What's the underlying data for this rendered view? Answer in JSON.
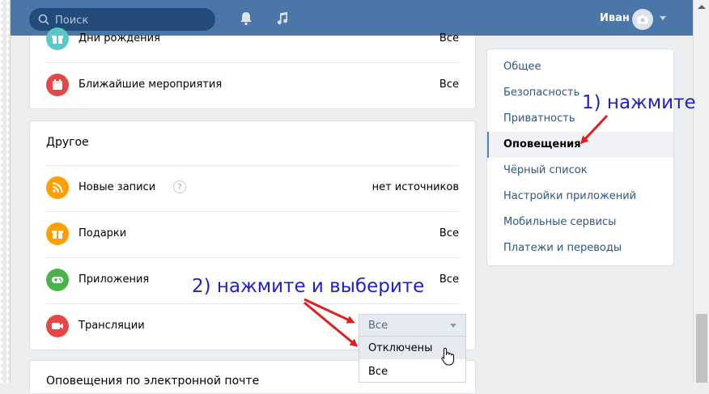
{
  "header": {
    "search_placeholder": "Поиск",
    "user_name": "Иван",
    "icons": [
      "search-icon",
      "bell-icon",
      "music-icon",
      "camera-icon",
      "chevron-down-icon"
    ]
  },
  "sections": {
    "events": {
      "rows": [
        {
          "label": "Дни рождения",
          "value": "Все",
          "icon": "gift-icon",
          "color": "#5ac8c8"
        },
        {
          "label": "Ближайшие мероприятия",
          "value": "Все",
          "icon": "calendar-icon",
          "color": "#e64646"
        }
      ]
    },
    "other": {
      "title": "Другое",
      "rows": [
        {
          "label": "Новые записи",
          "value": "нет источников",
          "icon": "rss-icon",
          "color": "#ffa000"
        },
        {
          "label": "Подарки",
          "value": "Все",
          "icon": "gift-icon",
          "color": "#ffa000"
        },
        {
          "label": "Приложения",
          "value": "Все",
          "icon": "gamepad-icon",
          "color": "#4bb34b"
        },
        {
          "label": "Трансляции",
          "icon": "video-icon",
          "color": "#e64646"
        }
      ],
      "help_symbol": "?"
    },
    "email": {
      "title": "Оповещения по электронной почте"
    }
  },
  "dropdown": {
    "selected": "Все",
    "options": [
      "Отключены",
      "Все"
    ]
  },
  "menu": {
    "items": [
      {
        "label": "Общее"
      },
      {
        "label": "Безопасность"
      },
      {
        "label": "Приватность"
      },
      {
        "label": "Оповещения",
        "active": true
      },
      {
        "label": "Чёрный список"
      },
      {
        "label": "Настройки приложений"
      },
      {
        "label": "Мобильные сервисы"
      },
      {
        "label": "Платежи и переводы"
      }
    ]
  },
  "annotations": {
    "step1": "1) нажмите",
    "step2": "2) нажмите и выберите",
    "color": "#1f1fd0",
    "arrow_color": "#e02020"
  },
  "colors": {
    "header": "#4a76a8",
    "link": "#2a5885",
    "background": "#edeef0"
  }
}
